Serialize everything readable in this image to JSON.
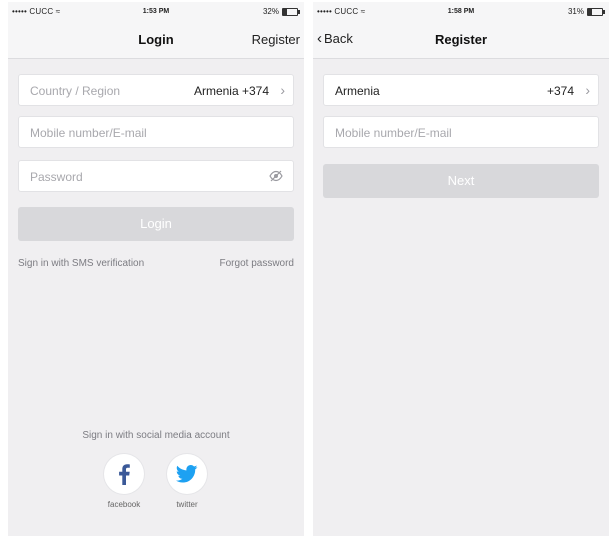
{
  "left": {
    "status": {
      "carrier": "••••• CUCC",
      "time": "1:53 PM",
      "battery": "32%",
      "battery_level": 0.32
    },
    "nav": {
      "title": "Login",
      "register": "Register"
    },
    "country": {
      "label": "Country / Region",
      "value": "Armenia +374"
    },
    "mobile": {
      "placeholder": "Mobile number/E-mail"
    },
    "password": {
      "placeholder": "Password"
    },
    "login_button": "Login",
    "sms_link": "Sign in with SMS verification",
    "forgot_link": "Forgot password",
    "social_title": "Sign in with social media account",
    "facebook": "facebook",
    "twitter": "twitter"
  },
  "right": {
    "status": {
      "carrier": "••••• CUCC",
      "time": "1:58 PM",
      "battery": "31%",
      "battery_level": 0.31
    },
    "nav": {
      "back": "Back",
      "title": "Register"
    },
    "country": {
      "value_left": "Armenia",
      "value_right": "+374"
    },
    "mobile": {
      "placeholder": "Mobile number/E-mail"
    },
    "next_button": "Next"
  },
  "colors": {
    "facebook": "#3b5998",
    "twitter": "#1da1f2",
    "background": "#f0eff1",
    "button_disabled": "#d8d8db"
  },
  "icons": [
    "wifi-icon",
    "battery-icon",
    "chevron-right-icon",
    "eye-off-icon",
    "back-chevron-icon",
    "facebook-icon",
    "twitter-icon"
  ]
}
